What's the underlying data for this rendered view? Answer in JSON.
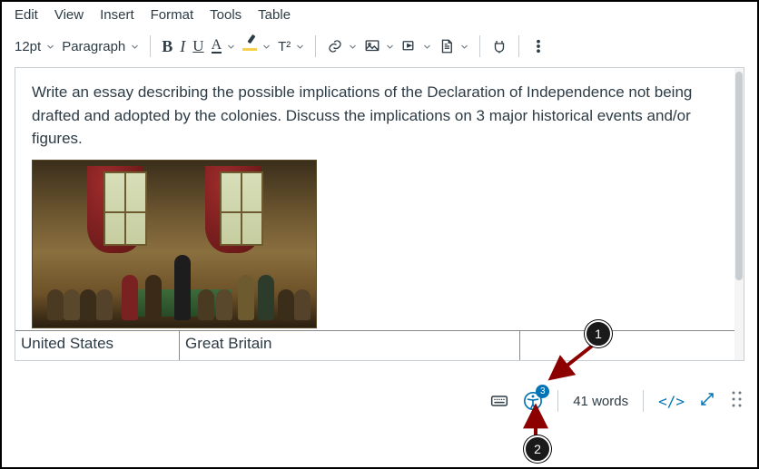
{
  "menu": {
    "edit": "Edit",
    "view": "View",
    "insert": "Insert",
    "format": "Format",
    "tools": "Tools",
    "table": "Table"
  },
  "toolbar": {
    "fontsize": "12pt",
    "block": "Paragraph",
    "superscript": "T²"
  },
  "editor": {
    "prompt": "Write an essay describing the possible implications of the Declaration of Independence not being drafted and adopted by the colonies. Discuss the implications on 3 major historical events and/or figures."
  },
  "table_row": {
    "c1": "United States",
    "c2": "Great Britain",
    "c3": ""
  },
  "status": {
    "a11y_count": "3",
    "words": "41 words",
    "code": "</>"
  },
  "callouts": {
    "one": "1",
    "two": "2"
  }
}
